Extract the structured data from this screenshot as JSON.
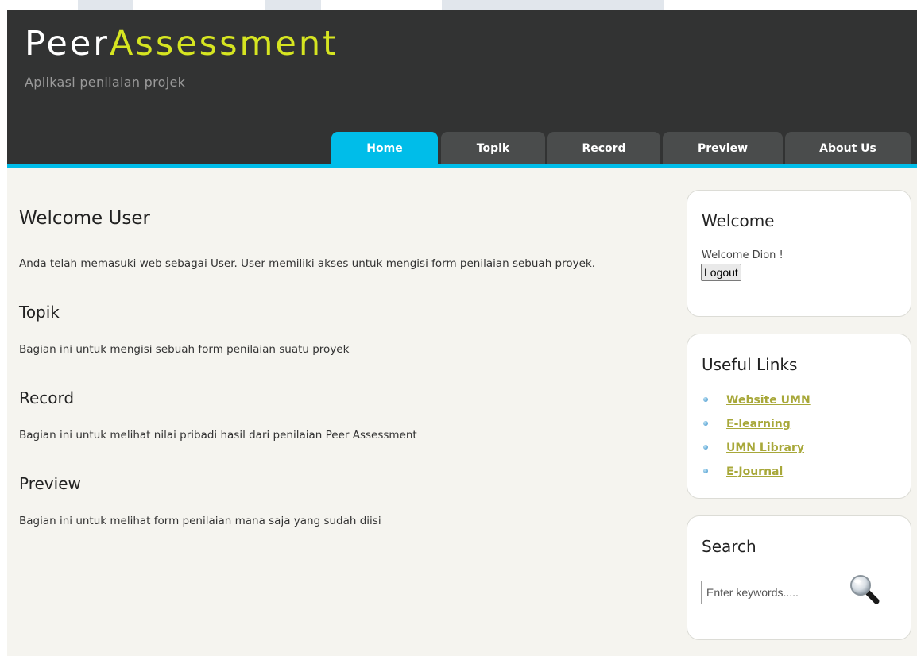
{
  "header": {
    "logo_part1": "Peer",
    "logo_part2": "Assessment",
    "slogan": "Aplikasi penilaian projek"
  },
  "menu": {
    "tabs": [
      {
        "label": "Home",
        "active": true
      },
      {
        "label": "Topik",
        "active": false
      },
      {
        "label": "Record",
        "active": false
      },
      {
        "label": "Preview",
        "active": false
      },
      {
        "label": "About Us",
        "active": false
      }
    ]
  },
  "main": {
    "title": "Welcome User",
    "intro": "Anda telah memasuki web sebagai User. User memiliki akses untuk mengisi form penilaian sebuah proyek.",
    "sections": [
      {
        "heading": "Topik",
        "text": "Bagian ini untuk mengisi sebuah form penilaian suatu proyek"
      },
      {
        "heading": "Record",
        "text": "Bagian ini untuk melihat nilai pribadi hasil dari penilaian Peer Assessment"
      },
      {
        "heading": "Preview",
        "text": "Bagian ini untuk melihat form penilaian mana saja yang sudah diisi"
      }
    ]
  },
  "sidebar": {
    "welcome": {
      "heading": "Welcome",
      "message": "Welcome Dion !",
      "logout_label": "Logout"
    },
    "links": {
      "heading": "Useful Links",
      "items": [
        {
          "label": "Website UMN"
        },
        {
          "label": "E-learning"
        },
        {
          "label": "UMN Library"
        },
        {
          "label": "E-Journal"
        }
      ]
    },
    "search": {
      "heading": "Search",
      "placeholder": "Enter keywords.....",
      "icon": "magnifier-icon"
    }
  },
  "colors": {
    "header_bg": "#323333",
    "accent_yellow": "#d6e521",
    "accent_blue": "#00bde9",
    "tab_bg": "#4a4c4c",
    "page_bg": "#f5f4ef",
    "link": "#a8a83a"
  }
}
